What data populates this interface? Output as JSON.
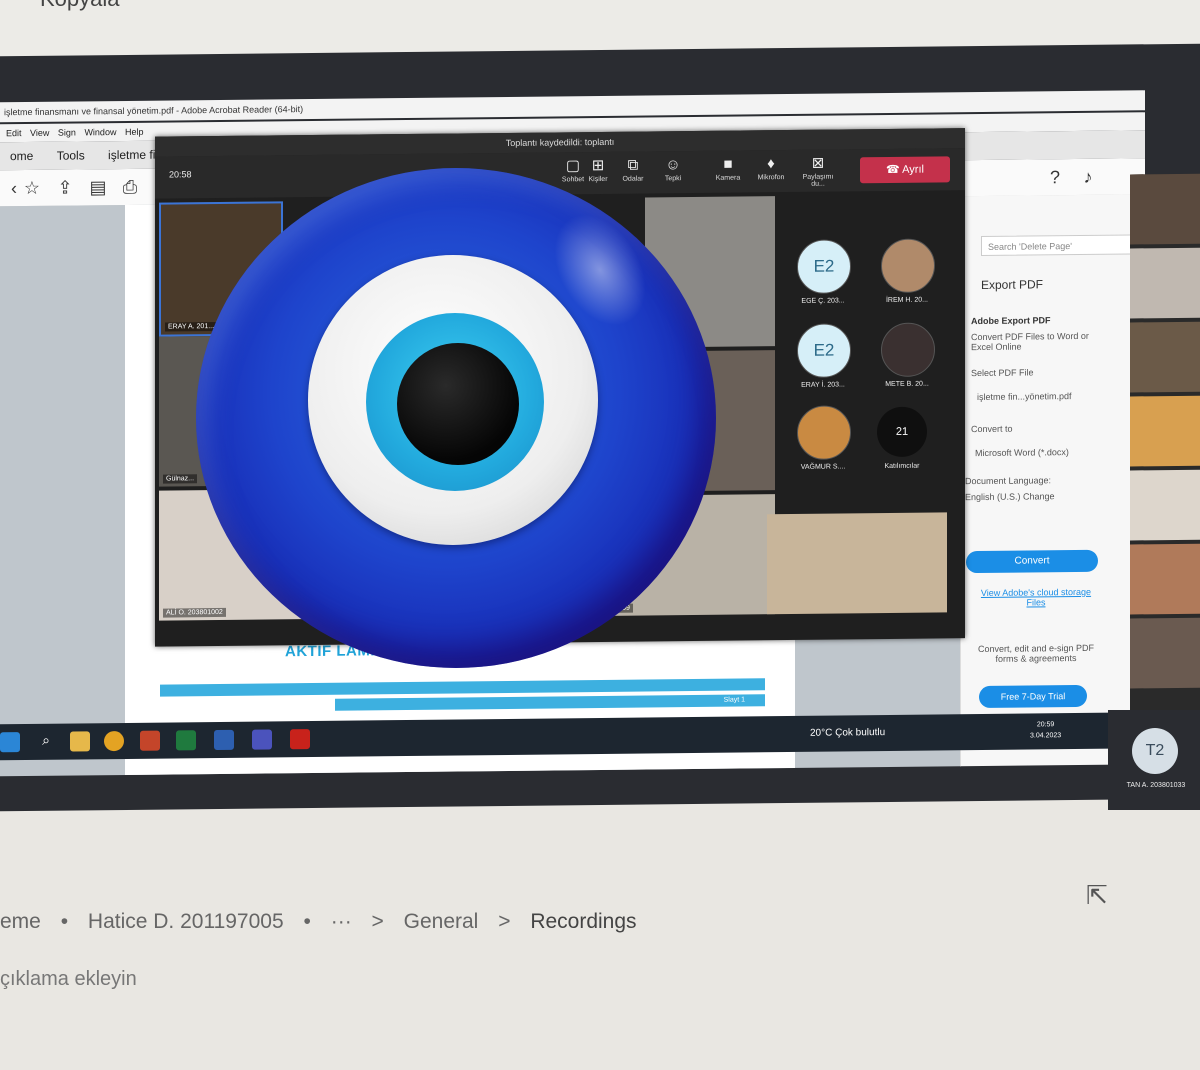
{
  "top": {
    "kopyala": "Kopyala"
  },
  "acrobat": {
    "title": "işletme finansmanı ve finansal yönetim.pdf - Adobe Acrobat Reader (64-bit)",
    "menu": [
      "Edit",
      "View",
      "Sign",
      "Window",
      "Help"
    ],
    "tabs": [
      "ome",
      "Tools",
      "işletme fi..."
    ],
    "heading": "AKTİF                                      LAMI",
    "bar_text": "Slayt 1"
  },
  "teams": {
    "title": "Toplantı kaydedildi: toplantı",
    "timer": "20:58",
    "toolbar": [
      "Sohbet",
      "Kişiler",
      "Odalar",
      "Tepki",
      "Kamera",
      "Mikrofon",
      "Paylaşımı du..."
    ],
    "leave_label": "Ayrıl",
    "tiles": [
      {
        "name": "ERAY A. 201..."
      },
      {
        "name": "Gülnaz..."
      },
      {
        "name": "ALİ O. 203801002"
      },
      {
        "name": "...C 203801059"
      }
    ],
    "avatars": [
      {
        "initials": "E2",
        "name": "EGE Ç. 203..."
      },
      {
        "initials": "",
        "name": "İREM H. 20..."
      },
      {
        "initials": "E2",
        "name": "ERAY İ. 203..."
      },
      {
        "initials": "",
        "name": "METE B. 20..."
      },
      {
        "initials": "",
        "name": "VAĞMUR S...."
      }
    ],
    "attendees": {
      "count": "21",
      "label": "Katılımcılar"
    }
  },
  "export_panel": {
    "search_placeholder": "Search 'Delete Page'",
    "export_pdf": "Export PDF",
    "adobe_export": "Adobe Export PDF",
    "convert_desc": "Convert PDF Files to Word or Excel Online",
    "select_file": "Select PDF File",
    "file_name": "işletme fin...yönetim.pdf",
    "convert_to": "Convert to",
    "format": "Microsoft Word (*.docx)",
    "doc_language": "Document Language:",
    "language": "English (U.S.) Change",
    "convert_button": "Convert",
    "cloud_link": "View Adobe's cloud storage Files",
    "esign_text": "Convert, edit and e-sign PDF forms & agreements",
    "trial_button": "Free 7-Day Trial"
  },
  "taskbar": {
    "weather": "20°C  Çok bulutlu",
    "time": "20:59",
    "date": "3.04.2023"
  },
  "side_tile": {
    "initials": "T2",
    "name": "TAN A. 203801033"
  },
  "below": {
    "crumbs": [
      "eme",
      "•",
      "Hatice D. 201197005",
      "•",
      "···",
      ">",
      "General",
      ">",
      "Recordings"
    ],
    "desc": "çıklama ekleyin"
  },
  "colors": {
    "teams_leave": "#c4314b",
    "acrobat_blue": "#1b8ee6",
    "eye_blue": "#1e44cc",
    "iris": "#22a9dd"
  }
}
